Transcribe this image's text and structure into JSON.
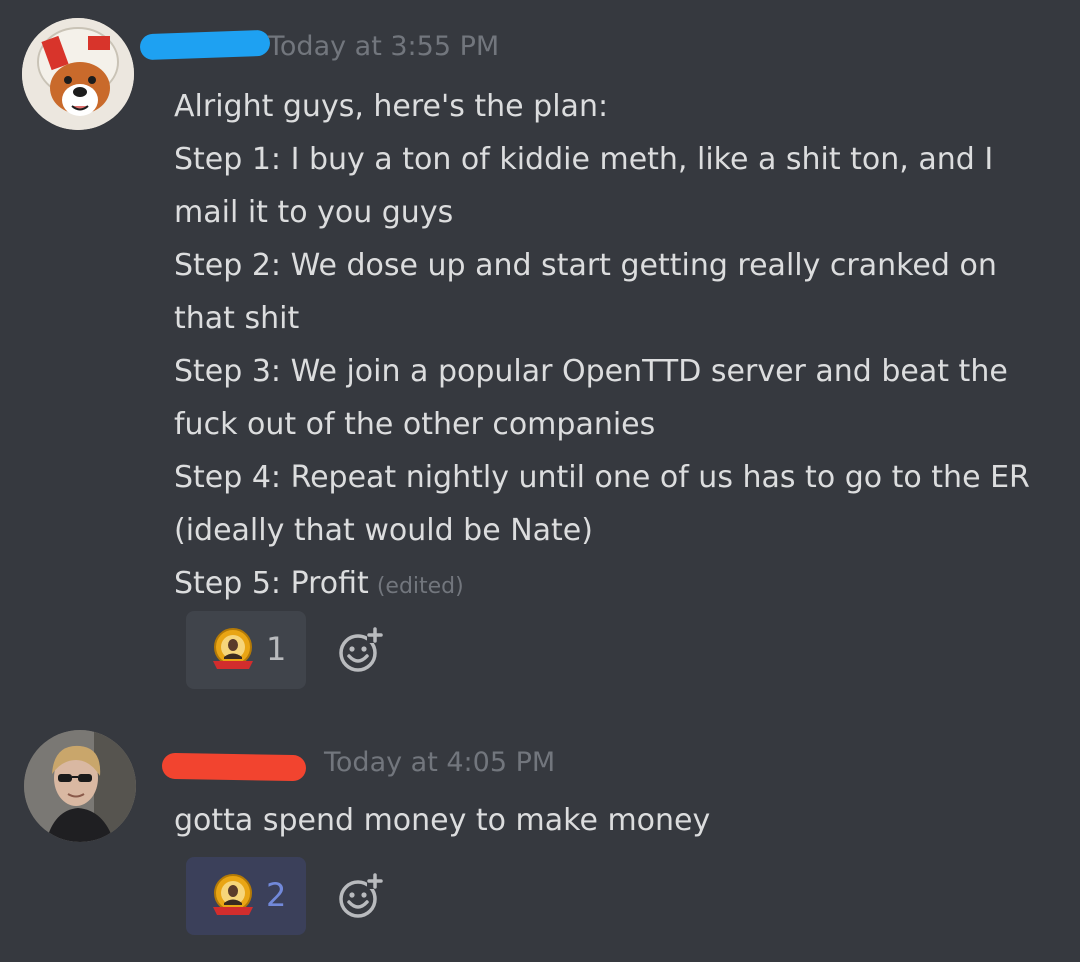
{
  "messages": [
    {
      "timestamp": "Today at 3:55 PM",
      "lines": [
        "Alright guys, here's the plan:",
        "Step 1: I buy a ton of kiddie meth, like a shit ton, and I",
        "mail it to you guys",
        "Step 2: We dose up and start getting really cranked on",
        "that shit",
        "Step 3: We join a popular OpenTTD server and beat the",
        "fuck out of the other companies",
        "Step 4: Repeat nightly until one of us has to go to the ER",
        "(ideally that would be Nate)",
        "Step 5: Profit"
      ],
      "edited_label": "(edited)",
      "reaction": {
        "emoji": "medal-portrait-emoji",
        "count": "1",
        "reacted": false
      }
    },
    {
      "timestamp": "Today at 4:05 PM",
      "lines": [
        "gotta spend money to make money"
      ],
      "reaction": {
        "emoji": "medal-portrait-emoji",
        "count": "2",
        "reacted": true
      }
    }
  ],
  "colors": {
    "background": "#36393f",
    "text": "#dcddde",
    "timestamp": "#72767d",
    "reaction_bg": "#40444b",
    "reaction_active_bg": "#3b405a",
    "reaction_active_text": "#7289da",
    "redaction_blue": "#1ea1f2",
    "redaction_red": "#f2442f"
  },
  "icons": {
    "add_reaction": "add-reaction-icon"
  }
}
